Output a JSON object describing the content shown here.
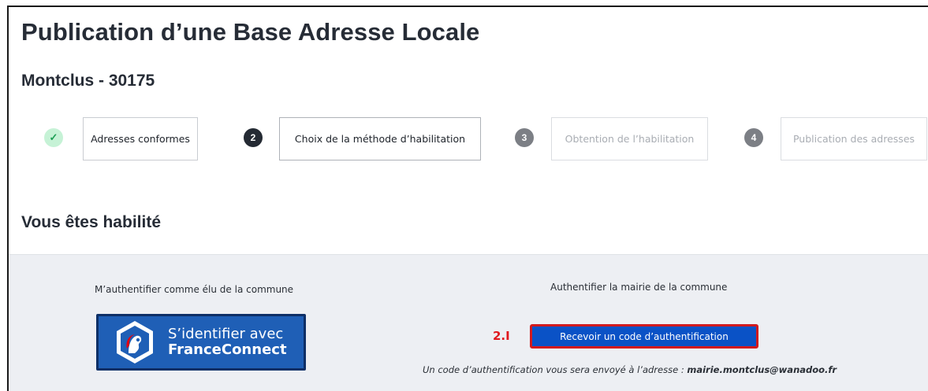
{
  "page": {
    "title": "Publication d’une Base Adresse Locale",
    "commune": "Montclus - 30175"
  },
  "stepper": {
    "steps": [
      {
        "marker": "✓",
        "label": "Adresses conformes",
        "state": "done"
      },
      {
        "marker": "2",
        "label": "Choix de la méthode d’habilitation",
        "state": "active"
      },
      {
        "marker": "3",
        "label": "Obtention de l’habilitation",
        "state": "todo"
      },
      {
        "marker": "4",
        "label": "Publication des adresses",
        "state": "todo"
      }
    ]
  },
  "habilitation": {
    "title": "Vous êtes habilité",
    "elu_label": "M’authentifier comme élu de la commune",
    "franceconnect": {
      "line1": "S’identifier avec",
      "line2": "FranceConnect"
    },
    "mairie_label": "Authentifier la mairie de la commune",
    "annotation": "2.I",
    "code_button": "Recevoir un code d’authentification",
    "email_prefix": "Un code d’authentification vous sera envoyé à l’adresse :",
    "email": "mairie.montclus@wanadoo.fr"
  },
  "colors": {
    "franceconnect_blue": "#1f5fb6",
    "primary_button": "#0a52c6",
    "annotation_red": "#e0191e",
    "step_done_bg": "#c6f2d6",
    "step_active_bg": "#242a33",
    "panel_bg": "#edeff3"
  }
}
